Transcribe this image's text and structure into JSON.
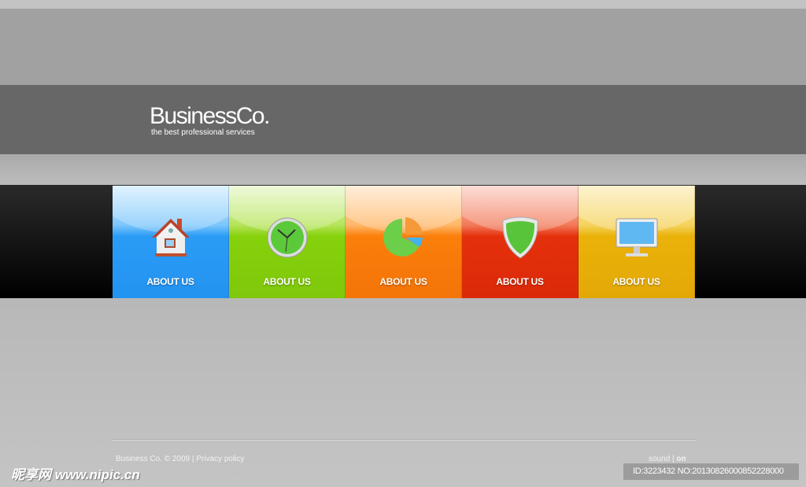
{
  "header": {
    "brand": "BusinessCo.",
    "tagline": "the best professional services"
  },
  "tiles": [
    {
      "label": "ABOUT US",
      "icon": "house-icon",
      "color": "#2a9cf6"
    },
    {
      "label": "ABOUT US",
      "icon": "clock-icon",
      "color": "#86d10c"
    },
    {
      "label": "ABOUT US",
      "icon": "pie-chart-icon",
      "color": "#fb7f0b"
    },
    {
      "label": "ABOUT US",
      "icon": "shield-icon",
      "color": "#e5300c"
    },
    {
      "label": "ABOUT US",
      "icon": "monitor-icon",
      "color": "#eab209"
    }
  ],
  "footer": {
    "copyright": "Business Co. © 2009",
    "separator": "|",
    "privacy": "Privacy policy",
    "sound": "sound",
    "sound_state": "on"
  },
  "watermark": {
    "site": "昵享网 www.nipic.cn",
    "id": "ID:3223432 NO:20130826000852228000"
  }
}
